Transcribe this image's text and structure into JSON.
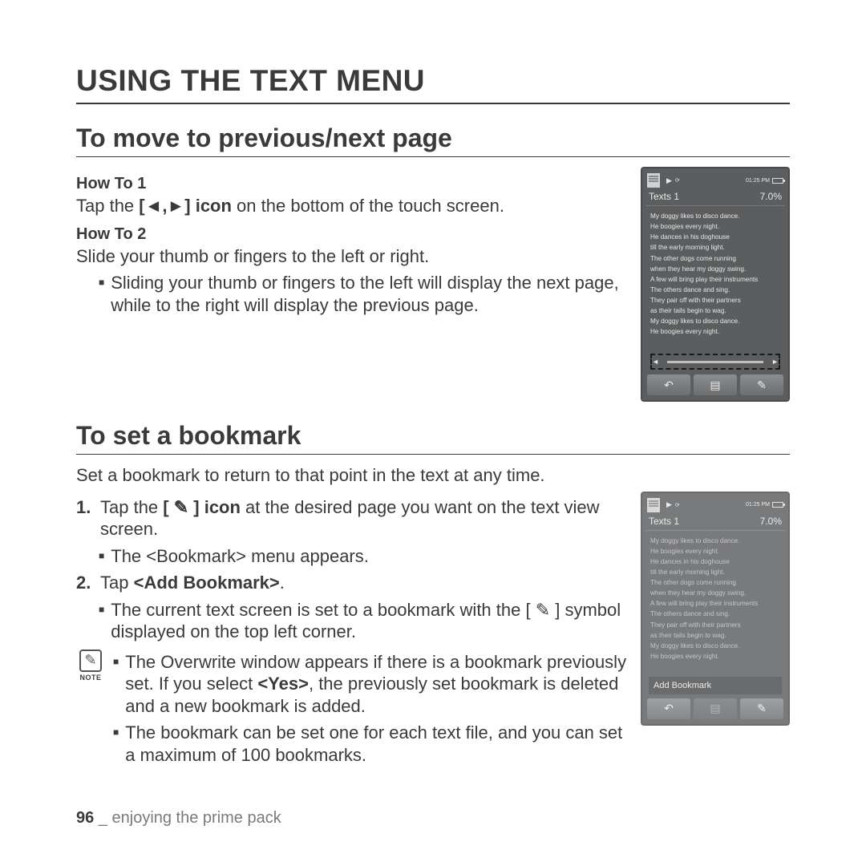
{
  "title": "USING THE TEXT MENU",
  "section1": {
    "heading": "To move to previous/next page",
    "howto1_label": "How To 1",
    "howto1_text_a": "Tap the ",
    "howto1_text_bold": "[◄,►] icon",
    "howto1_text_b": " on the bottom of the touch screen.",
    "howto2_label": "How To 2",
    "howto2_text": "Slide your thumb or fingers to the left or right.",
    "howto2_bullet": "Sliding your thumb or fingers to the left will display the next page, while to the right will display the previous page."
  },
  "section2": {
    "heading": "To set a bookmark",
    "intro": "Set a bookmark to return to that point in the text at any time.",
    "step1_num": "1.",
    "step1_a": "Tap the ",
    "step1_bold": "[ ✎ ] icon",
    "step1_b": " at the desired page you want on the text view screen.",
    "step1_bullet": "The <Bookmark> menu appears.",
    "step2_num": "2.",
    "step2_a": "Tap ",
    "step2_bold": "<Add Bookmark>",
    "step2_b": ".",
    "step2_bullet": "The current text screen is set to a bookmark with the [ ✎ ] symbol displayed on the top left corner.",
    "note_label": "NOTE",
    "note1_a": "The Overwrite window appears if there is a bookmark previously set. If you select ",
    "note1_bold": "<Yes>",
    "note1_b": ", the previously set bookmark is deleted and a new bookmark is added.",
    "note2": "The bookmark can be set one for each text file, and you can set a maximum of 100 bookmarks."
  },
  "phone": {
    "time": "01:25 PM",
    "title": "Texts 1",
    "percent": "7.0%",
    "lines": [
      "My doggy likes to disco dance.",
      "He boogies every night.",
      "He dances in his doghouse",
      "till the early morning light.",
      "The other dogs come running",
      "when they hear my doggy swing.",
      "A few will bring play their instruments",
      "The others dance and sing.",
      "They pair off with their partners",
      "as their tails begin to wag.",
      "My doggy likes to disco dance.",
      "He boogies every night."
    ],
    "add_bookmark": "Add Bookmark"
  },
  "footer": {
    "page": "96",
    "sep": " _ ",
    "chapter": "enjoying the prime pack"
  }
}
